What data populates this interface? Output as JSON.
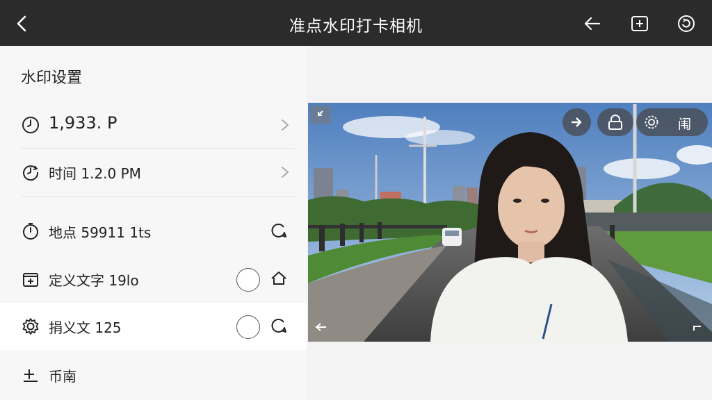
{
  "header": {
    "title": "准点水印打卡相机",
    "icons": [
      "back-chevron-icon",
      "arrow-left-icon",
      "add-square-icon",
      "refresh-circle-icon"
    ]
  },
  "settings": {
    "title": "水印设置",
    "items": [
      {
        "icon": "clock-icon",
        "label": "1,933. P"
      },
      {
        "icon": "clock-arrow-icon",
        "label": "时间 1.2.0 PM"
      },
      {
        "icon": "stopwatch-icon",
        "label": "地点 59911 1ts"
      },
      {
        "icon": "box-plus-icon",
        "label": "定义文字 19lo"
      },
      {
        "icon": "gear-icon",
        "label": "捐义文 125"
      },
      {
        "icon": "plus-corner-icon",
        "label": "币南"
      }
    ]
  },
  "overlay": {
    "lock_label": "闱",
    "icons": [
      "arrow-right-icon",
      "lock-icon",
      "settings-icon"
    ]
  },
  "colors": {
    "topbar": "#2b2b2b",
    "panel": "#f7f7f7",
    "highlight": "#ffffff",
    "text": "#222222"
  }
}
